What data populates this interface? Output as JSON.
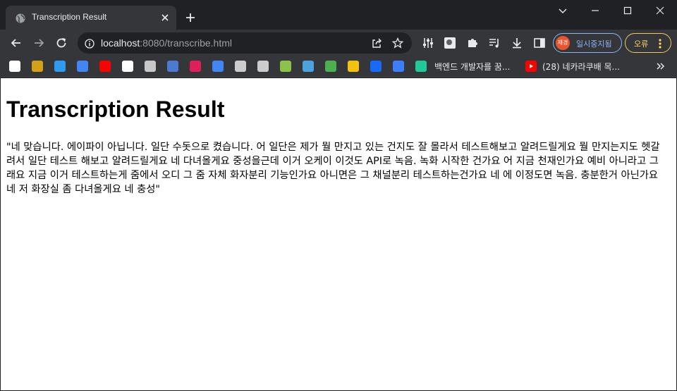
{
  "browser": {
    "tab": {
      "title": "Transcription Result"
    },
    "omnibox": {
      "host": "localhost",
      "path": ":8080/transcribe.html"
    },
    "profile": {
      "avatar_text": "재경",
      "label": "일시중지됨"
    },
    "error_button": {
      "label": "오류"
    },
    "bookmarks": [
      {
        "icon": "github-icon",
        "color": "#ffffff"
      },
      {
        "icon": "bookmark-2-icon",
        "color": "#d4a017"
      },
      {
        "icon": "h-logo-icon",
        "color": "#2e9bf0"
      },
      {
        "icon": "bookmark-4-icon",
        "color": "#4285f4"
      },
      {
        "icon": "youtube-icon",
        "color": "#ff0000"
      },
      {
        "icon": "l-logo-icon",
        "color": "#ffffff"
      },
      {
        "icon": "bookmark-7-icon",
        "color": "#c8c8c8"
      },
      {
        "icon": "bookmark-8-icon",
        "color": "#4a7bd0"
      },
      {
        "icon": "slack-icon",
        "color": "#e01e5a"
      },
      {
        "icon": "translate-icon",
        "color": "#4285f4"
      },
      {
        "icon": "bookmark-11-icon",
        "color": "#cccccc"
      },
      {
        "icon": "globe-icon",
        "color": "#cccccc"
      },
      {
        "icon": "bookmark-13-icon",
        "color": "#8bc34a"
      },
      {
        "icon": "code-icon",
        "color": "#4aa3df"
      },
      {
        "icon": "bookmark-15-icon",
        "color": "#4caf50"
      },
      {
        "icon": "bookmark-16-icon",
        "color": "#f4c20d"
      },
      {
        "icon": "behance-icon",
        "color": "#1769ff"
      },
      {
        "icon": "bookmark-18-icon",
        "color": "#3d7dff"
      },
      {
        "icon": "d2-icon",
        "color": "#20c997"
      }
    ],
    "bookmark_labels": {
      "b1": "백엔드 개발자를 꿈...",
      "b2": "(28) 네카라쿠배 목..."
    }
  },
  "page": {
    "title": "Transcription Result",
    "transcript": "\"네 맞습니다. 에이파이 아닙니다. 일단 수돗으로 켰습니다. 어 일단은 제가 뭘 만지고 있는 건지도 잘 몰라서 테스트해보고 알려드릴게요 뭘 만지는지도 헷갈려서 일단 테스트 해보고 알려드릴게요 네 다녀올게요 중성을근데 이거 오케이 이것도 API로 녹음. 녹화 시작한 건가요 어 지금 천재인가요 예비 아니라고 그래요 지금 이거 테스트하는게 줌에서 오디 그 줌 자체 화자분리 기능인가요 아니면은 그 채널분리 테스트하는건가요 네 에 이정도면 녹음. 충분한거 아닌가요 네 저 화장실 좀 다녀올게요 네 충성\""
  }
}
